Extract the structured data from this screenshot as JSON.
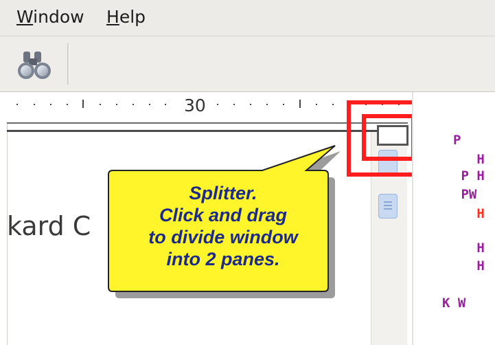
{
  "menu": {
    "window_mnemonic": "W",
    "window_rest": "indow",
    "help_mnemonic": "H",
    "help_rest": "elp"
  },
  "toolbar": {
    "find_icon": "binoculars-icon"
  },
  "ruler": {
    "label": "30"
  },
  "document": {
    "text": "kard C"
  },
  "callout": {
    "line1": "Splitter.",
    "line2": "Click and drag",
    "line3": "to divide window",
    "line4": "into 2 panes."
  },
  "right_pane": {
    "lines": [
      {
        "text": "P",
        "color": "#9a1f9e"
      },
      {
        "text": "   H",
        "color": "#9a1f9e"
      },
      {
        "text": " P H",
        "color": "#9a1f9e"
      },
      {
        "text": " PW",
        "color": "#9a1f9e"
      },
      {
        "text": "   H",
        "color": "#ff2d1e"
      },
      {
        "text": "   H",
        "color": "#9a1f9e"
      },
      {
        "text": "   H",
        "color": "#9a1f9e"
      },
      {
        "text": "K W",
        "color": "#9a1f9e"
      }
    ]
  },
  "colors": {
    "highlight": "#ff1e1e",
    "callout_fill": "#fff52a",
    "callout_text": "#1c2a8a",
    "keyword_purple": "#9a1f9e",
    "keyword_red": "#ff2d1e"
  }
}
